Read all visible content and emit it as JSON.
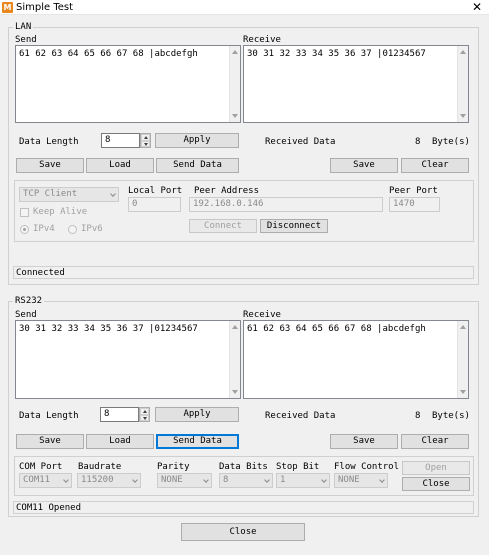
{
  "window": {
    "title": "Simple Test",
    "app_icon_letter": "M",
    "close_glyph": "✕"
  },
  "lan": {
    "group_label": "LAN",
    "send_label": "Send",
    "receive_label": "Receive",
    "send_text": "61 62 63 64 65 66 67 68 |abcdefgh",
    "receive_text": "30 31 32 33 34 35 36 37 |01234567",
    "data_length_label": "Data Length",
    "data_length_value": "8",
    "apply_label": "Apply",
    "received_data_label": "Received Data",
    "received_count": "8",
    "bytes_label": "Byte(s)",
    "save_label": "Save",
    "load_label": "Load",
    "send_data_label": "Send Data",
    "receive_save_label": "Save",
    "clear_label": "Clear",
    "connection": {
      "protocol_value": "TCP Client",
      "keep_alive_label": "Keep Alive",
      "local_port_label": "Local Port",
      "local_port_value": "0",
      "peer_address_label": "Peer Address",
      "peer_address_value": "192.168.0.146",
      "peer_port_label": "Peer Port",
      "peer_port_value": "1470",
      "ipv4_label": "IPv4",
      "ipv6_label": "IPv6",
      "connect_label": "Connect",
      "disconnect_label": "Disconnect"
    },
    "status_text": "Connected"
  },
  "rs232": {
    "group_label": "RS232",
    "send_label": "Send",
    "receive_label": "Receive",
    "send_text": "30 31 32 33 34 35 36 37 |01234567",
    "receive_text": "61 62 63 64 65 66 67 68 |abcdefgh",
    "data_length_label": "Data Length",
    "data_length_value": "8",
    "apply_label": "Apply",
    "received_data_label": "Received Data",
    "received_count": "8",
    "bytes_label": "Byte(s)",
    "save_label": "Save",
    "load_label": "Load",
    "send_data_label": "Send Data",
    "receive_save_label": "Save",
    "clear_label": "Clear",
    "settings": {
      "com_port_label": "COM Port",
      "com_port_value": "COM11",
      "baudrate_label": "Baudrate",
      "baudrate_value": "115200",
      "parity_label": "Parity",
      "parity_value": "NONE",
      "data_bits_label": "Data Bits",
      "data_bits_value": "8",
      "stop_bit_label": "Stop Bit",
      "stop_bit_value": "1",
      "flow_control_label": "Flow Control",
      "flow_control_value": "NONE",
      "open_label": "Open",
      "close_label": "Close"
    },
    "status_text": "COM11 Opened"
  },
  "footer": {
    "close_label": "Close"
  }
}
